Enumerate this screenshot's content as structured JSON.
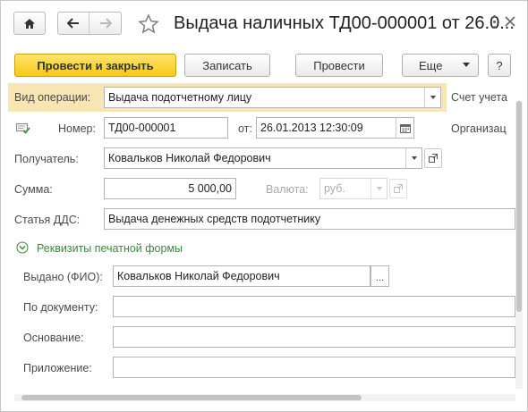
{
  "title": "Выдача наличных ТД00-000001 от 26.0...",
  "toolbar": {
    "post_close": "Провести и закрыть",
    "write": "Записать",
    "post": "Провести",
    "more": "Еще",
    "help": "?"
  },
  "form": {
    "op_label": "Вид операции:",
    "op_value": "Выдача подотчетному лицу",
    "account_label": "Счет учета",
    "num_label": "Номер:",
    "num_value": "ТД00-000001",
    "date_label": "от:",
    "date_value": "26.01.2013 12:30:09",
    "org_label": "Организац",
    "recipient_label": "Получатель:",
    "recipient_value": "Ковальков  Николай Федорович",
    "sum_label": "Сумма:",
    "sum_value": "5 000,00",
    "currency_label": "Валюта:",
    "currency_value": "руб.",
    "dds_label": "Статья ДДС:",
    "dds_value": "Выдача денежных средств подотчетнику"
  },
  "print_group": {
    "header": "Реквизиты печатной формы",
    "issued_label": "Выдано (ФИО):",
    "issued_value": "Ковальков  Николай Федорович",
    "doc_label": "По документу:",
    "doc_value": "",
    "basis_label": "Основание:",
    "basis_value": "",
    "attachment_label": "Приложение:",
    "attachment_value": ""
  },
  "icons": {
    "home": "home-icon",
    "back": "arrow-left-icon",
    "forward": "arrow-right-icon",
    "favorite": "star-icon",
    "menu": "more-vertical-icon",
    "close": "close-icon",
    "posted": "posted-doc-icon",
    "calendar": "calendar-icon",
    "open": "open-link-icon",
    "dropdown": "chevron-down-icon",
    "ellipsis": "ellipsis-icon",
    "collapse": "chevron-down-circle-icon"
  },
  "colors": {
    "primary_button": "#f7c817",
    "highlight_row": "#f7e6b4",
    "group_link": "#3a8a3a"
  }
}
